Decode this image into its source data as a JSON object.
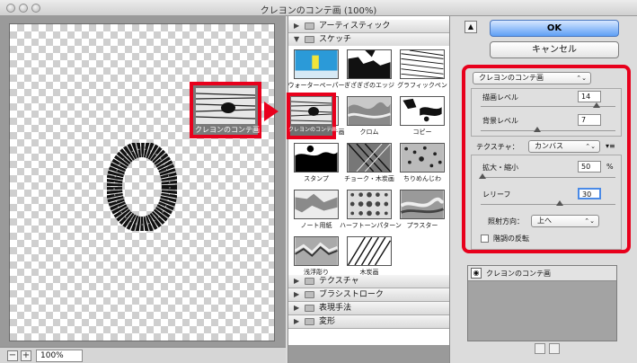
{
  "window": {
    "title": "クレヨンのコンテ画 (100%)"
  },
  "preview": {
    "zoom": "100%",
    "minus_label": "−",
    "plus_label": "+"
  },
  "callout": {
    "label": "クレヨンのコンテ画"
  },
  "gallery": {
    "categories_top": [
      {
        "label": "アーティスティック",
        "expanded": false,
        "triangle": "▶"
      },
      {
        "label": "スケッチ",
        "expanded": true,
        "triangle": "▼"
      }
    ],
    "items": [
      "ウォーターペーパー",
      "ぎざぎざのエッジ",
      "グラフィックペン",
      "クレヨンのコンテ画",
      "クロム",
      "コピー",
      "スタンプ",
      "チョーク・木炭画",
      "ちりめんじわ",
      "ノート用紙",
      "ハーフトーンパターン",
      "プラスター",
      "浅浮彫り",
      "木炭画"
    ],
    "categories_bottom": [
      {
        "label": "テクスチャ",
        "triangle": "▶"
      },
      {
        "label": "ブラシストローク",
        "triangle": "▶"
      },
      {
        "label": "表現手法",
        "triangle": "▶"
      },
      {
        "label": "変形",
        "triangle": "▶"
      }
    ]
  },
  "dialog": {
    "collapse_glyph": "▲",
    "ok_label": "OK",
    "cancel_label": "キャンセル",
    "filter_select": "クレヨンのコンテ画",
    "popup_chevron": "⌃⌄",
    "foreground_label": "描画レベル",
    "foreground_value": "14",
    "background_label": "背景レベル",
    "background_value": "7",
    "texture_label": "テクスチャ：",
    "texture_select": "カンバス",
    "texture_menu_glyph": "▾≡",
    "scaling_label": "拡大・縮小",
    "scaling_value": "50",
    "scaling_unit": "%",
    "relief_label": "レリーフ",
    "relief_value": "30",
    "light_label": "照射方向：",
    "light_select": "上へ",
    "invert_label": "階調の反転"
  },
  "layers": {
    "items": [
      {
        "name": "クレヨンのコンテ画",
        "eye": "◉"
      }
    ]
  },
  "colors": {
    "highlight": "#e8001c",
    "ok_button": "#5e9ff5"
  }
}
